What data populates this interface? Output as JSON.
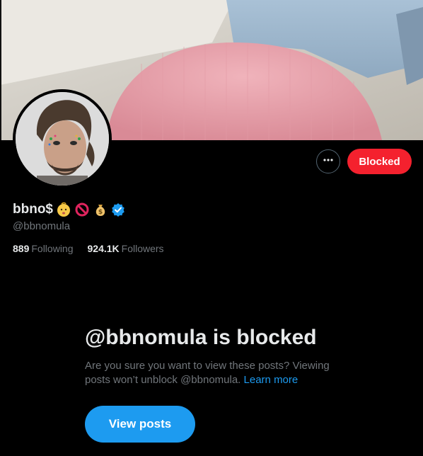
{
  "profile": {
    "display_name": "bbno$",
    "handle": "@bbnomula",
    "emojis": [
      "baby-face-icon",
      "prohibited-icon",
      "money-bag-icon"
    ],
    "verified": true
  },
  "actions": {
    "more_icon": "more-horizontal-icon",
    "blocked_label": "Blocked"
  },
  "stats": {
    "following_count": "889",
    "following_label": "Following",
    "followers_count": "924.1K",
    "followers_label": "Followers"
  },
  "blocked_notice": {
    "title": "@bbnomula is blocked",
    "description": "Are you sure you want to view these posts? Viewing posts won’t unblock @bbnomula.",
    "learn_more": "Learn more",
    "view_posts_label": "View posts"
  },
  "colors": {
    "background": "#000000",
    "blocked_red": "#f4212e",
    "accent_blue": "#1d9bf0",
    "secondary_text": "#71767b",
    "primary_text": "#e7e9ea"
  }
}
